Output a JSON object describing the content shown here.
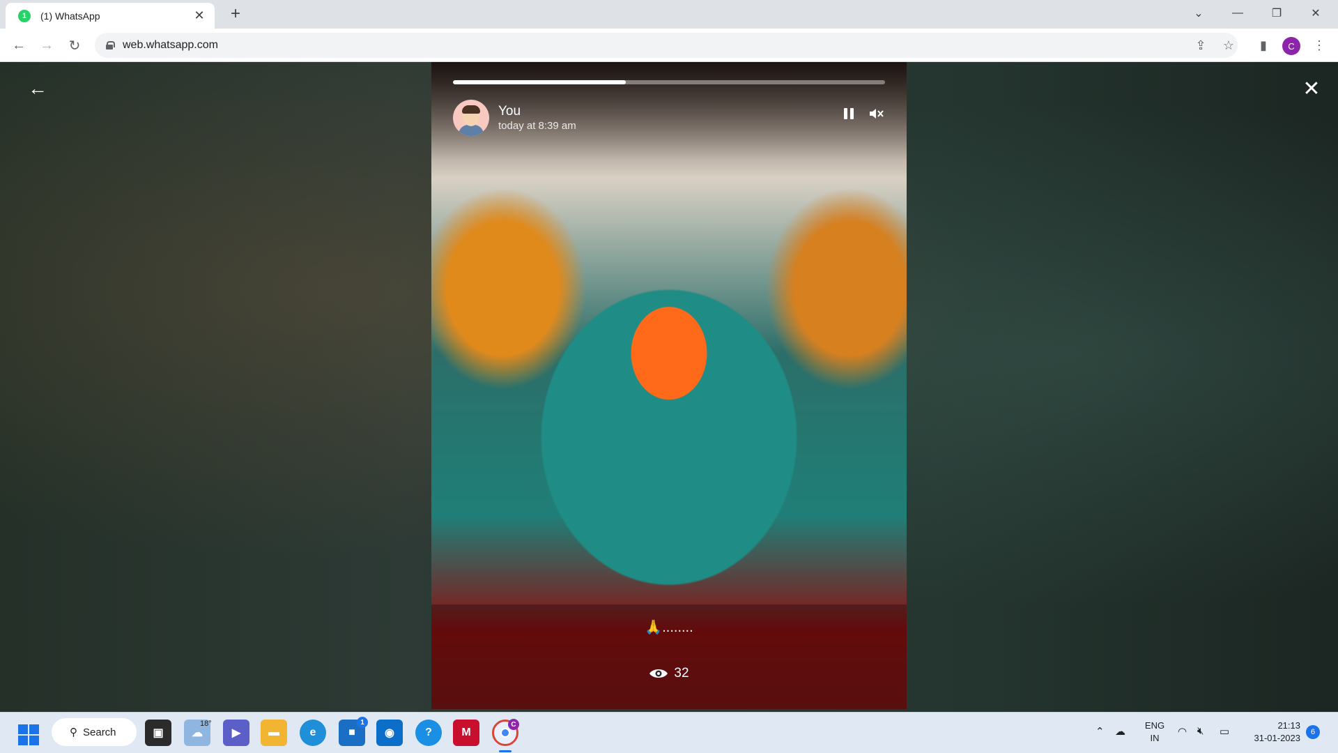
{
  "browser": {
    "tab": {
      "title": "(1) WhatsApp",
      "favicon_text": "1"
    },
    "url": "web.whatsapp.com",
    "profile_initial": "C"
  },
  "status": {
    "progress_fraction": 0.4,
    "sender_name": "You",
    "timestamp": "today at 8:39 am",
    "caption": "🙏........",
    "views_count": "32"
  },
  "taskbar": {
    "search_label": "Search",
    "weather_temp": "18°",
    "store_badge": "1",
    "chrome_badge": "C",
    "language": {
      "line1": "ENG",
      "line2": "IN"
    },
    "time": "21:13",
    "date": "31-01-2023",
    "notification_count": "6"
  },
  "colors": {
    "whatsapp_green": "#25d366",
    "accent_blue": "#1a73e8",
    "profile_purple": "#8e24aa"
  }
}
